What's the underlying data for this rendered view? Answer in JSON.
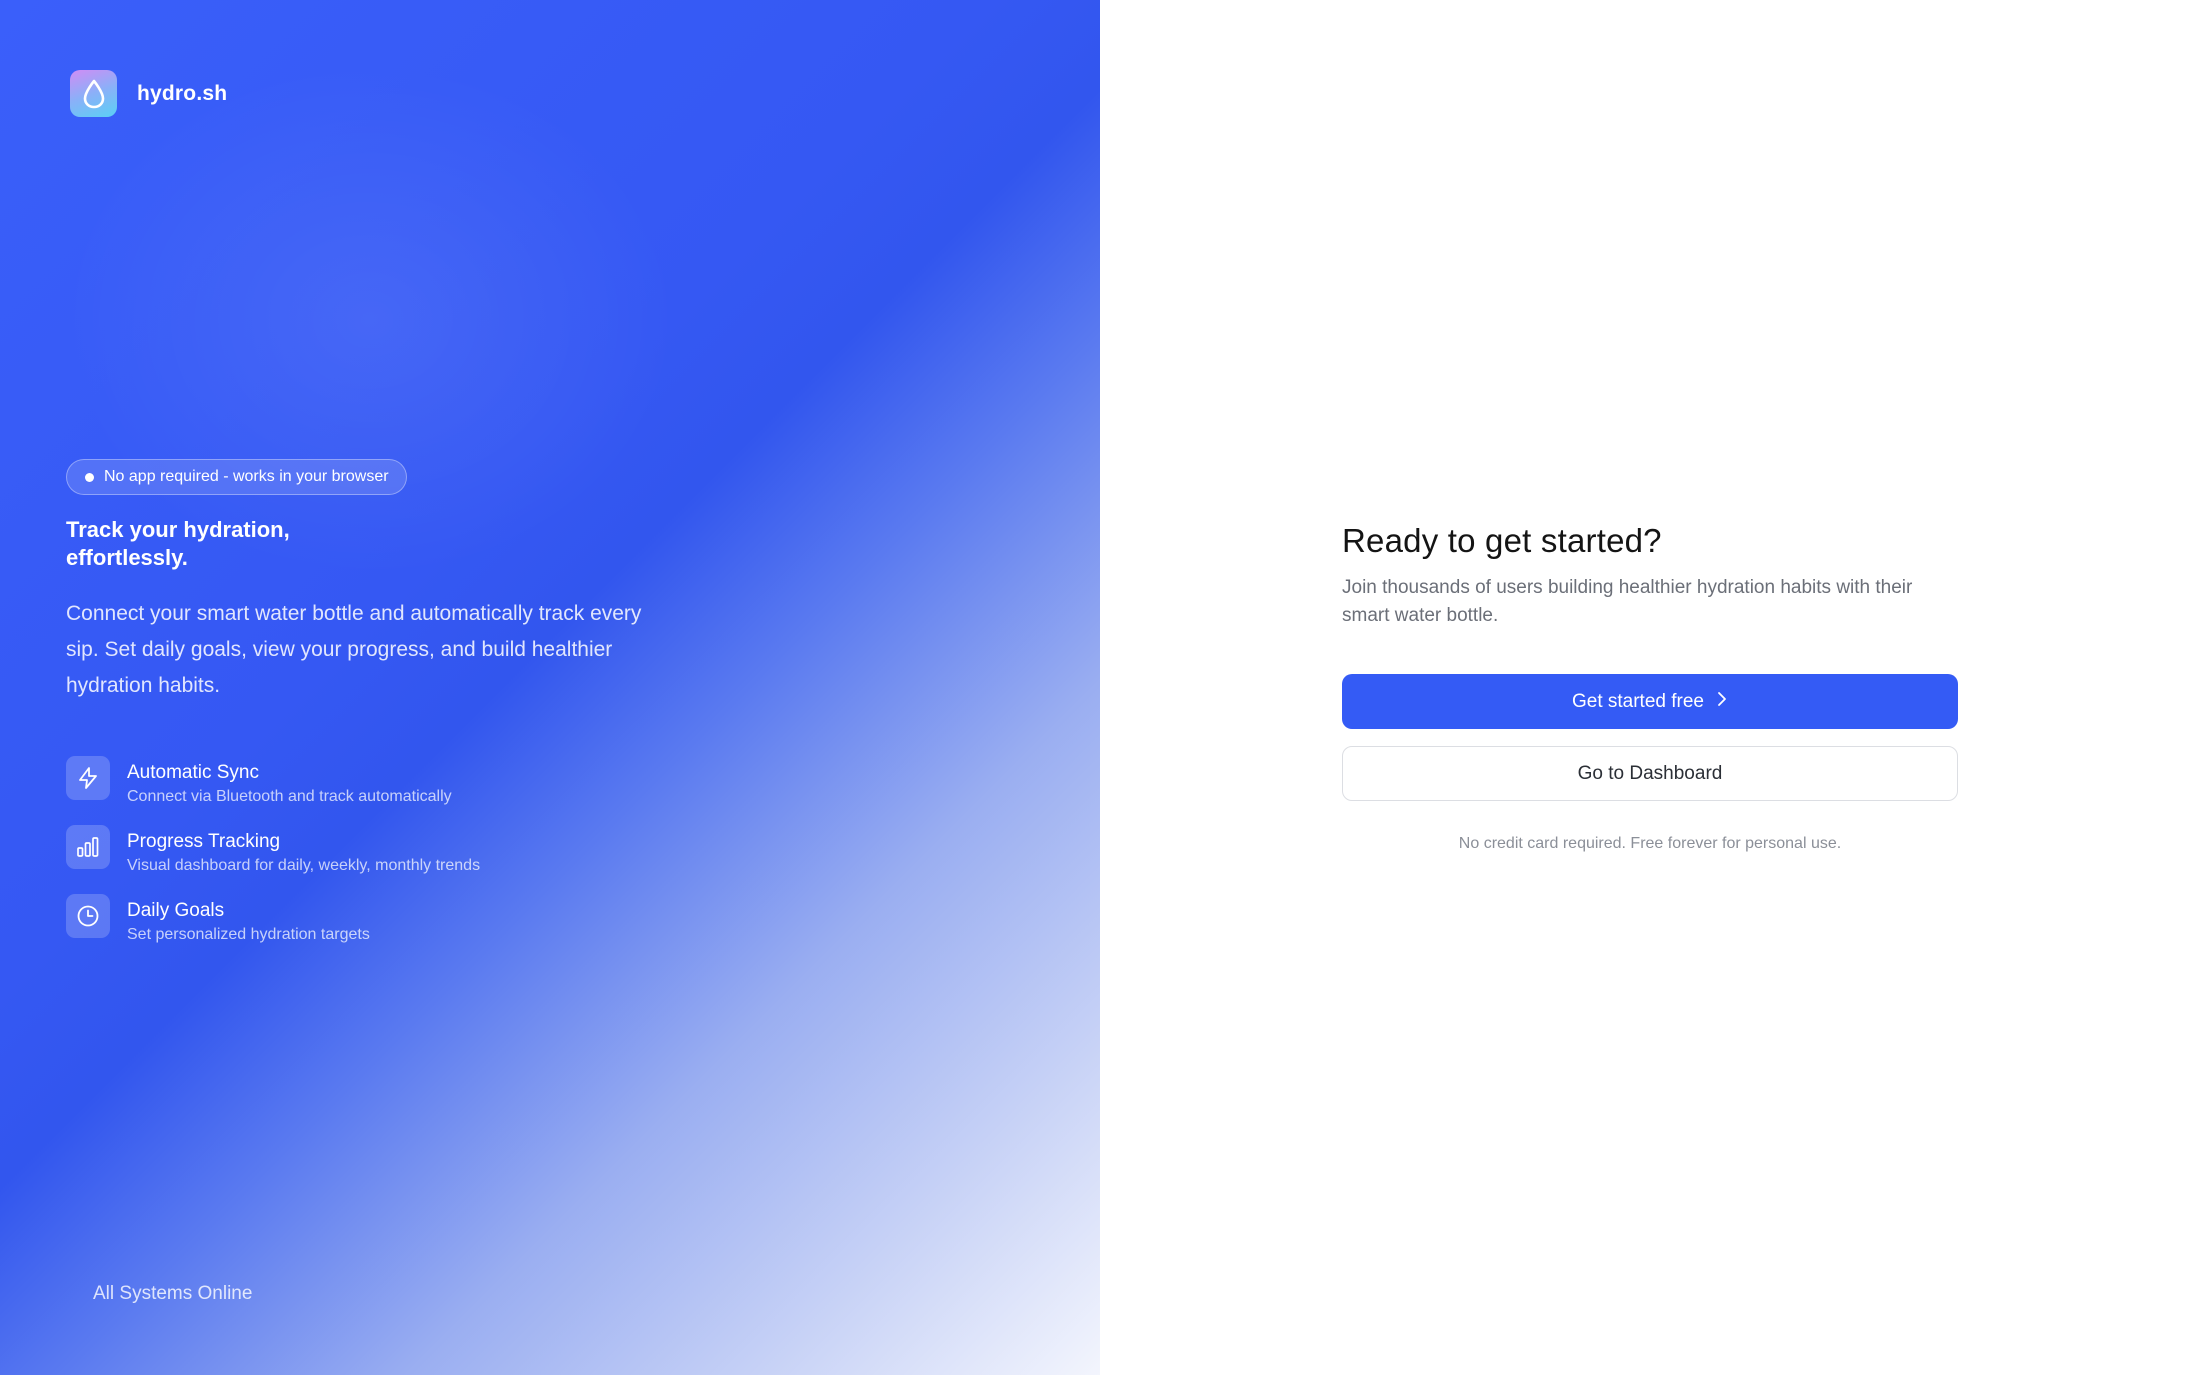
{
  "brand": {
    "name": "hydro.sh",
    "logo_icon": "water-drop-icon"
  },
  "hero": {
    "badge": "No app required - works in your browser",
    "headline_line1": "Track your hydration,",
    "headline_line2": "effortlessly.",
    "description": "Connect your smart water bottle and automatically track every sip. Set daily goals, view your progress, and build healthier hydration habits.",
    "features": [
      {
        "icon": "lightning-bolt-icon",
        "title": "Automatic Sync",
        "description": "Connect via Bluetooth and track automatically"
      },
      {
        "icon": "bar-chart-icon",
        "title": "Progress Tracking",
        "description": "Visual dashboard for daily, weekly, monthly trends"
      },
      {
        "icon": "clock-icon",
        "title": "Daily Goals",
        "description": "Set personalized hydration targets"
      }
    ],
    "status": "All Systems Online"
  },
  "cta": {
    "title": "Ready to get started?",
    "subtitle": "Join thousands of users building healthier hydration habits with their smart water bottle.",
    "primary_label": "Get started free",
    "secondary_label": "Go to Dashboard",
    "fineprint": "No credit card required. Free forever for personal use."
  },
  "colors": {
    "accent": "#345bf5",
    "hero_gradient_start": "#3a5ffa",
    "hero_gradient_end": "#f3f5fd",
    "text_dark": "#141414",
    "text_muted": "#6b6f78"
  }
}
